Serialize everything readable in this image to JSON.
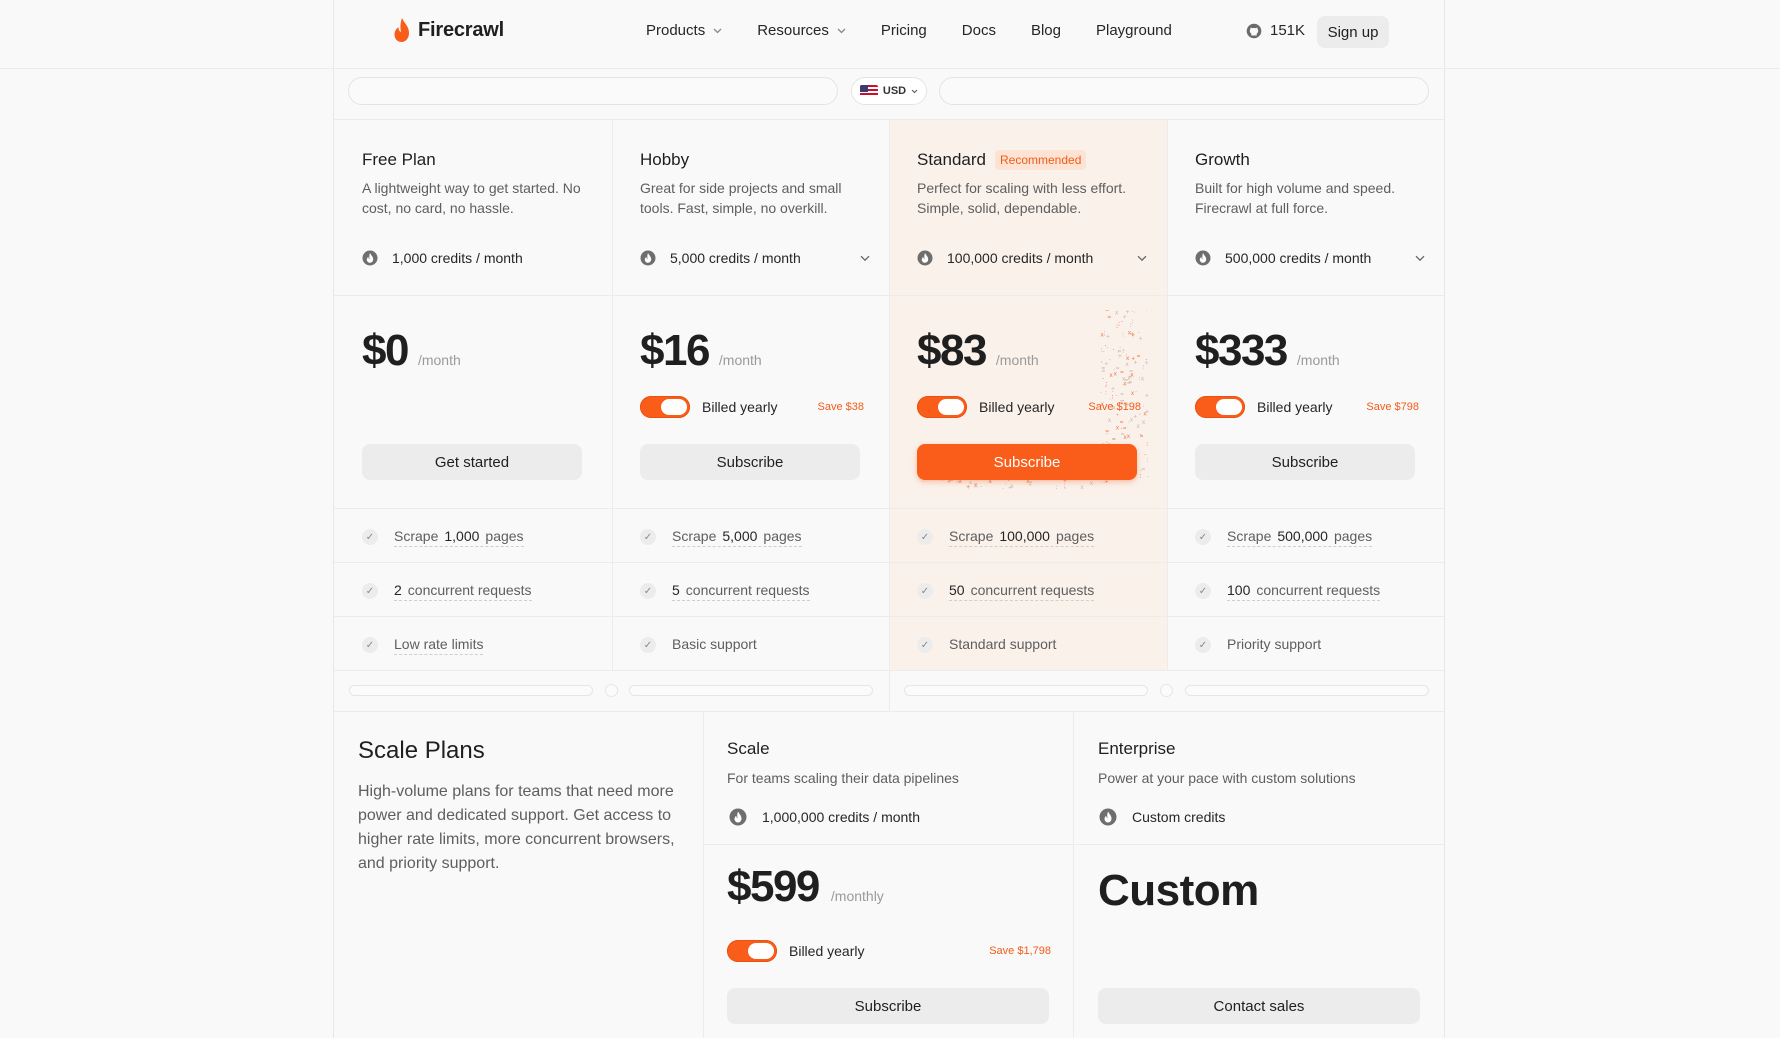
{
  "brand": {
    "name": "Firecrawl",
    "accent": "#fa5d19"
  },
  "nav": {
    "items": [
      {
        "label": "Products",
        "has_dropdown": true
      },
      {
        "label": "Resources",
        "has_dropdown": true
      },
      {
        "label": "Pricing",
        "has_dropdown": false
      },
      {
        "label": "Docs",
        "has_dropdown": false
      },
      {
        "label": "Blog",
        "has_dropdown": false
      },
      {
        "label": "Playground",
        "has_dropdown": false
      }
    ],
    "github_stars": "151K",
    "signup_label": "Sign up"
  },
  "currency": {
    "selected": "USD",
    "icon": "us-flag-icon"
  },
  "plans": [
    {
      "name": "Free Plan",
      "badge": "",
      "desc": "A lightweight way to get started. No cost, no card, no hassle.",
      "credits": "1,000 credits / month",
      "price": "$0",
      "period": "/month",
      "billing_label": "",
      "save": "",
      "button": "Get started",
      "features": [
        {
          "pre": "Scrape",
          "num": "1,000",
          "post": "pages"
        },
        {
          "pre": "",
          "num": "2",
          "post": "concurrent requests"
        },
        {
          "pre": "Low rate limits",
          "num": "",
          "post": ""
        }
      ]
    },
    {
      "name": "Hobby",
      "badge": "",
      "desc": "Great for side projects and small tools. Fast, simple, no overkill.",
      "credits": "5,000 credits / month",
      "price": "$16",
      "period": "/month",
      "billing_label": "Billed yearly",
      "save": "Save $38",
      "button": "Subscribe",
      "features": [
        {
          "pre": "Scrape",
          "num": "5,000",
          "post": "pages"
        },
        {
          "pre": "",
          "num": "5",
          "post": "concurrent requests"
        },
        {
          "pre": "Basic support",
          "num": "",
          "post": ""
        }
      ]
    },
    {
      "name": "Standard",
      "badge": "Recommended",
      "desc": "Perfect for scaling with less effort. Simple, solid, dependable.",
      "credits": "100,000 credits / month",
      "price": "$83",
      "period": "/month",
      "billing_label": "Billed yearly",
      "save": "Save $198",
      "button": "Subscribe",
      "features": [
        {
          "pre": "Scrape",
          "num": "100,000",
          "post": "pages"
        },
        {
          "pre": "",
          "num": "50",
          "post": "concurrent requests"
        },
        {
          "pre": "Standard support",
          "num": "",
          "post": ""
        }
      ]
    },
    {
      "name": "Growth",
      "badge": "",
      "desc": "Built for high volume and speed. Firecrawl at full force.",
      "credits": "500,000 credits / month",
      "price": "$333",
      "period": "/month",
      "billing_label": "Billed yearly",
      "save": "Save $798",
      "button": "Subscribe",
      "features": [
        {
          "pre": "Scrape",
          "num": "500,000",
          "post": "pages"
        },
        {
          "pre": "",
          "num": "100",
          "post": "concurrent requests"
        },
        {
          "pre": "Priority support",
          "num": "",
          "post": ""
        }
      ]
    }
  ],
  "scale": {
    "title": "Scale Plans",
    "desc": "High-volume plans for teams that need more power and dedicated support. Get access to higher rate limits, more concurrent browsers, and priority support.",
    "plans": [
      {
        "name": "Scale",
        "desc": "For teams scaling their data pipelines",
        "credits": "1,000,000 credits / month",
        "price": "$599",
        "period": "/monthly",
        "billing_label": "Billed yearly",
        "save": "Save $1,798",
        "button": "Subscribe"
      },
      {
        "name": "Enterprise",
        "desc": "Power at your pace with custom solutions",
        "credits": "Custom credits",
        "price": "Custom",
        "button": "Contact sales"
      }
    ]
  }
}
